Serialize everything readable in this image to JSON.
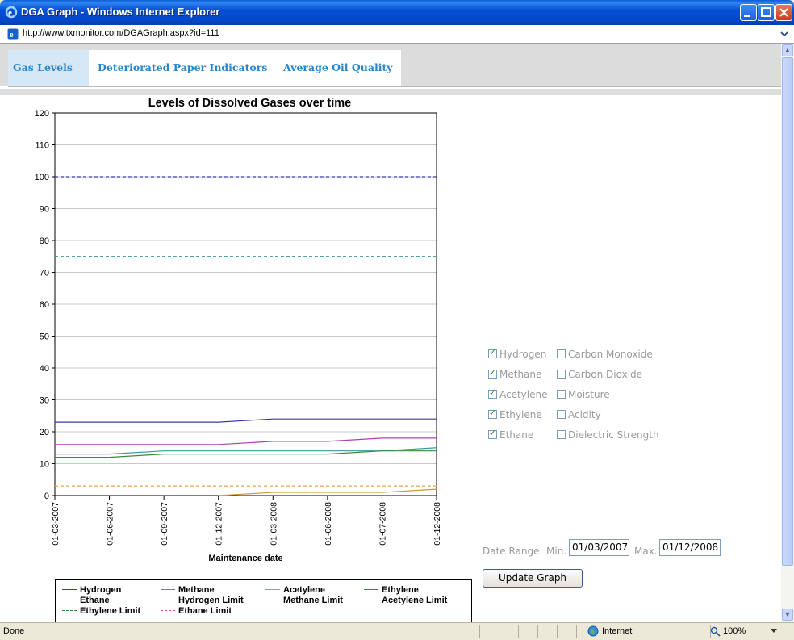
{
  "window": {
    "title": "DGA Graph - Windows Internet Explorer",
    "url": "http://www.txmonitor.com/DGAGraph.aspx?id=111"
  },
  "tabs": [
    {
      "label": "Gas Levels",
      "active": true
    },
    {
      "label": "Deteriorated Paper Indicators",
      "active": false
    },
    {
      "label": "Average Oil Quality",
      "active": false
    }
  ],
  "checkboxes": {
    "left": [
      {
        "label": "Hydrogen",
        "checked": true
      },
      {
        "label": "Methane",
        "checked": true
      },
      {
        "label": "Acetylene",
        "checked": true
      },
      {
        "label": "Ethylene",
        "checked": true
      },
      {
        "label": "Ethane",
        "checked": true
      }
    ],
    "right": [
      {
        "label": "Carbon Monoxide",
        "checked": false
      },
      {
        "label": "Carbon Dioxide",
        "checked": false
      },
      {
        "label": "Moisture",
        "checked": false
      },
      {
        "label": "Acidity",
        "checked": false
      },
      {
        "label": "Dielectric Strength",
        "checked": false
      }
    ]
  },
  "date_range": {
    "label": "Date Range:",
    "min_label": "Min.",
    "min_value": "01/03/2007",
    "max_label": "Max.",
    "max_value": "01/12/2008"
  },
  "update_button": "Update Graph",
  "status": {
    "text": "Done",
    "zone": "Internet",
    "zoom": "100%"
  },
  "chart_data": {
    "type": "line",
    "title": "Levels of Dissolved Gases over time",
    "xlabel": "Maintenance date",
    "ylabel": "",
    "ylim": [
      0,
      120
    ],
    "yticks": [
      0,
      10,
      20,
      30,
      40,
      50,
      60,
      70,
      80,
      90,
      100,
      110,
      120
    ],
    "grid": true,
    "legend_position": "bottom",
    "categories": [
      "01-03-2007",
      "01-06-2007",
      "01-09-2007",
      "01-12-2007",
      "01-03-2008",
      "01-06-2008",
      "01-07-2008",
      "01-12-2008"
    ],
    "series": [
      {
        "name": "Hydrogen",
        "color": "#3a3aa8",
        "dash": false,
        "values": [
          23,
          23,
          23,
          23,
          24,
          24,
          24,
          24
        ]
      },
      {
        "name": "Methane",
        "color": "#3a9a9a",
        "dash": false,
        "values": [
          13,
          13,
          14,
          14,
          14,
          14,
          14,
          15
        ]
      },
      {
        "name": "Acetylene",
        "color": "#c89a3a",
        "dash": false,
        "values": [
          null,
          null,
          null,
          0,
          1,
          1,
          1,
          2
        ]
      },
      {
        "name": "Ethylene",
        "color": "#3a8a3a",
        "dash": false,
        "values": [
          12,
          12,
          13,
          13,
          13,
          13,
          14,
          14
        ]
      },
      {
        "name": "Ethane",
        "color": "#b040b0",
        "dash": false,
        "values": [
          16,
          16,
          16,
          16,
          17,
          17,
          18,
          18
        ]
      },
      {
        "name": "Hydrogen Limit",
        "color": "#3a3aa8",
        "dash": true,
        "values": [
          100,
          100,
          100,
          100,
          100,
          100,
          100,
          100
        ]
      },
      {
        "name": "Methane Limit",
        "color": "#3a9a9a",
        "dash": true,
        "values": [
          75,
          75,
          75,
          75,
          75,
          75,
          75,
          75
        ]
      },
      {
        "name": "Acetylene Limit",
        "color": "#e8a050",
        "dash": true,
        "values": [
          3,
          3,
          3,
          3,
          3,
          3,
          3,
          3
        ]
      },
      {
        "name": "Ethylene Limit",
        "color": "#3a8a3a",
        "dash": true,
        "values": []
      },
      {
        "name": "Ethane Limit",
        "color": "#d050a0",
        "dash": true,
        "values": []
      }
    ]
  }
}
